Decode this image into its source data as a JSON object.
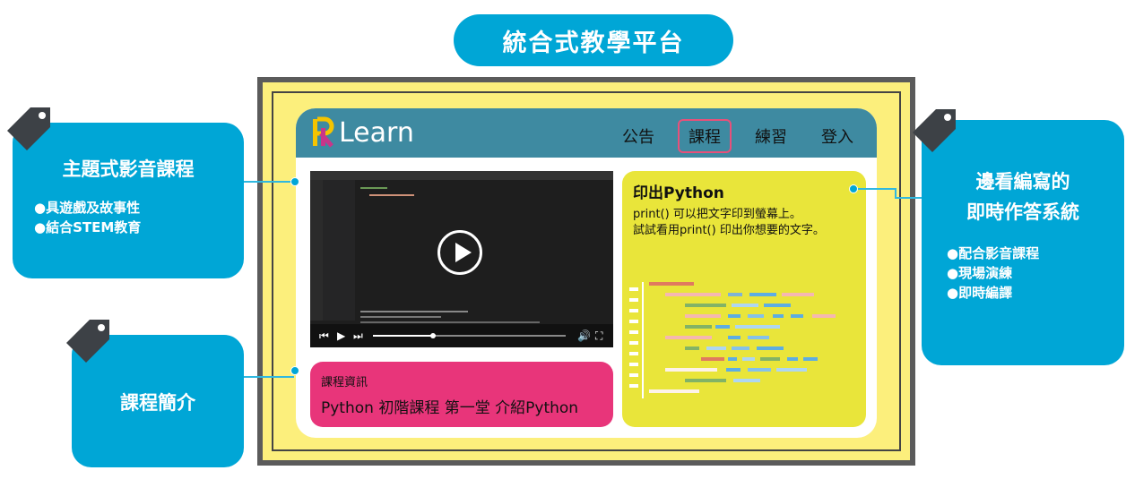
{
  "title": "統合式教學平台",
  "app": {
    "logo_text": "Learn",
    "nav": [
      "公告",
      "課程",
      "練習",
      "登入"
    ],
    "active_nav": "課程",
    "video": {
      "progress": 0.31
    },
    "course_info": {
      "label": "課程資訊",
      "course": "Python 初階課程 第一堂 介紹Python"
    },
    "exercise": {
      "title": "印出Python",
      "lines": [
        "print() 可以把文字印到螢幕上。",
        "試試看用print() 印出你想要的文字。"
      ]
    }
  },
  "callouts": {
    "video_lessons": {
      "title": "主題式影音課程",
      "bullets": [
        "●具遊戲及故事性",
        "●結合STEM教育"
      ]
    },
    "course_intro": {
      "title": "課程簡介"
    },
    "practice": {
      "title_line1": "邊看編寫的",
      "title_line2": "即時作答系統",
      "bullets": [
        "●配合影音課程",
        "●現場演練",
        "●即時編譯"
      ]
    }
  },
  "colors": {
    "accent": "#00a6d6",
    "navbar": "#3e8aa1",
    "info": "#e8357a",
    "exercise": "#e9e53a",
    "screen": "#fcef7c"
  }
}
